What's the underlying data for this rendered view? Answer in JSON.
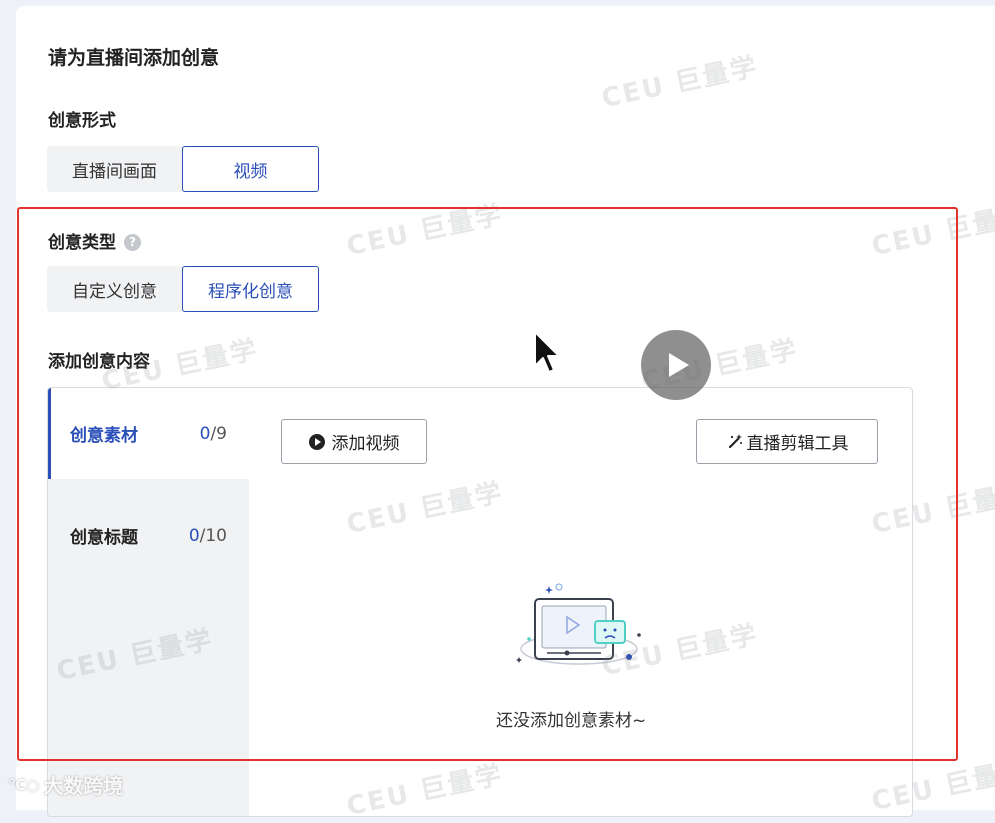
{
  "page": {
    "heading": "请为直播间添加创意"
  },
  "creative_form": {
    "label": "创意形式",
    "options": [
      "直播间画面",
      "视频"
    ],
    "selected": "视频"
  },
  "creative_type": {
    "label": "创意类型",
    "help_icon": "question-circle-icon",
    "options": [
      "自定义创意",
      "程序化创意"
    ],
    "selected": "程序化创意"
  },
  "content": {
    "label": "添加创意内容",
    "tabs": [
      {
        "label": "创意素材",
        "current": "0",
        "total": "/9"
      },
      {
        "label": "创意标题",
        "current": "0",
        "total": "/10"
      }
    ],
    "add_video_button": "添加视频",
    "live_edit_tool_button": "直播剪辑工具",
    "empty_text": "还没添加创意素材~"
  },
  "watermark": {
    "brand": "巨量学",
    "corner": "大数跨境"
  },
  "colors": {
    "accent": "#2a4fb8",
    "highlight_frame": "#e1332b"
  }
}
